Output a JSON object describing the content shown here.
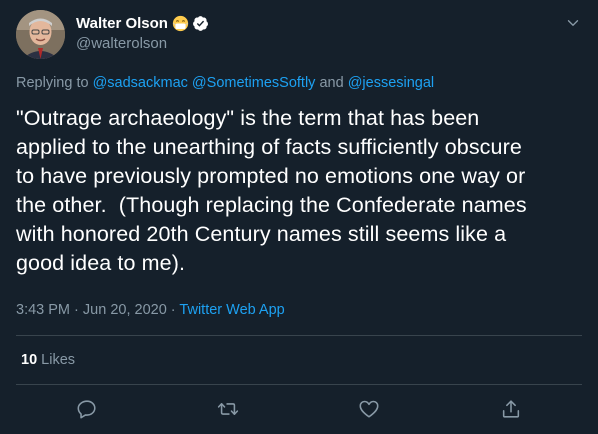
{
  "author": {
    "display_name": "Walter Olson",
    "handle": "@walterolson",
    "emoji": "face-with-medical-mask",
    "verified": true
  },
  "reply_to": {
    "prefix": "Replying to",
    "mentions": [
      "@sadsackmac",
      "@SometimesSoftly",
      "@jessesingal"
    ],
    "conjunction": "and"
  },
  "tweet": {
    "text_lines": [
      "\"Outrage archaeology\" is the term that has been",
      "applied to the unearthing of facts sufficiently obscure",
      "to have previously prompted no emotions one way or",
      "the other.  (Though replacing the Confederate names",
      "with honored 20th Century names still seems like a",
      "good idea to me)."
    ],
    "time": "3:43 PM",
    "separator": "·",
    "date": "Jun 20, 2020",
    "source": "Twitter Web App"
  },
  "stats": {
    "likes_count": "10",
    "likes_label": "Likes"
  },
  "actions": [
    {
      "name": "reply",
      "icon": "reply-icon"
    },
    {
      "name": "retweet",
      "icon": "retweet-icon"
    },
    {
      "name": "like",
      "icon": "heart-icon"
    },
    {
      "name": "share",
      "icon": "share-icon"
    }
  ],
  "colors": {
    "background": "#15202b",
    "text": "#ffffff",
    "secondary": "#8899a6",
    "accent": "#1da1f2",
    "divider": "#38444d"
  }
}
